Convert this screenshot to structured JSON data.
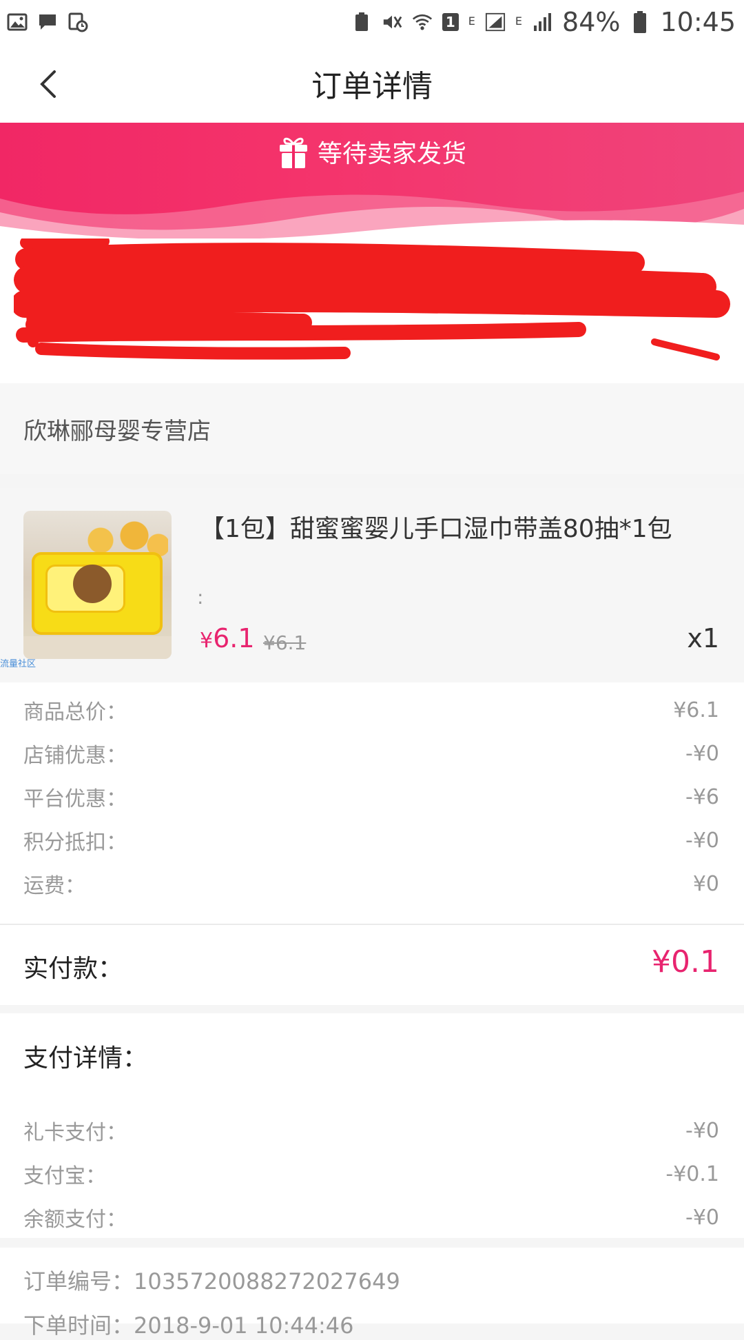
{
  "statusbar": {
    "network1": "E",
    "network2": "E",
    "sim_badge": "1",
    "battery": "84%",
    "time": "10:45"
  },
  "header": {
    "title": "订单详情"
  },
  "banner": {
    "status": "等待卖家发货"
  },
  "shop": {
    "name": "欣琳郦母婴专营店"
  },
  "product": {
    "title": "【1包】甜蜜蜜婴儿手口湿巾带盖80抽*1包",
    "spec": ":",
    "price_symbol": "¥",
    "price": "6.1",
    "original_price": "¥6.1",
    "quantity": "x1",
    "watermark": "流量社区"
  },
  "breakdown": {
    "rows": [
      {
        "label": "商品总价：",
        "value": "¥6.1"
      },
      {
        "label": "店铺优惠：",
        "value": "-¥0"
      },
      {
        "label": "平台优惠：",
        "value": "-¥6"
      },
      {
        "label": "积分抵扣：",
        "value": "-¥0"
      },
      {
        "label": "运费：",
        "value": "¥0"
      }
    ]
  },
  "total": {
    "label": "实付款：",
    "value": "¥0.1"
  },
  "payment": {
    "title": "支付详情：",
    "rows": [
      {
        "label": "礼卡支付：",
        "value": "-¥0"
      },
      {
        "label": "支付宝：",
        "value": "-¥0.1"
      },
      {
        "label": "余额支付：",
        "value": "-¥0"
      }
    ]
  },
  "order": {
    "number_label": "订单编号：",
    "number": "1035720088272027649",
    "time_label": "下单时间：",
    "time": "2018-9-01 10:44:46"
  },
  "colors": {
    "accent": "#e8246f",
    "banner": "#f12765"
  }
}
